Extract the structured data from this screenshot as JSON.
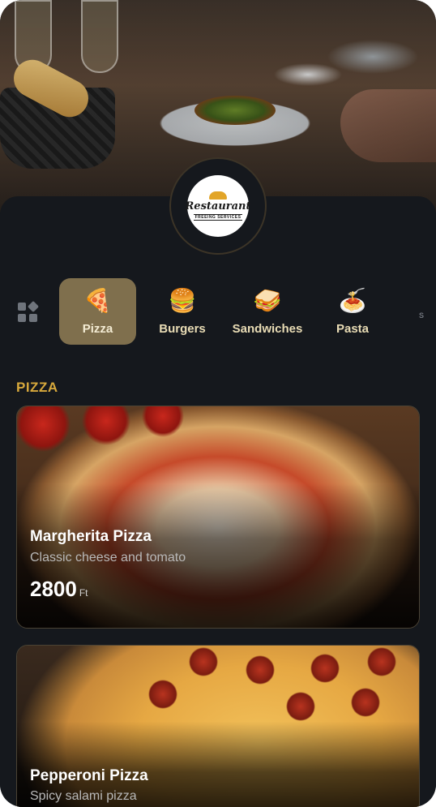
{
  "hero": {
    "logo_name": "Restaurant",
    "logo_sub": "FREEING SERVICES"
  },
  "categories": [
    {
      "label": "Pizza",
      "icon": "pizza-icon",
      "glyph": "🍕",
      "active": true
    },
    {
      "label": "Burgers",
      "icon": "burger-icon",
      "glyph": "🍔",
      "active": false
    },
    {
      "label": "Sandwiches",
      "icon": "sandwich-icon",
      "glyph": "🥪",
      "active": false
    },
    {
      "label": "Pasta",
      "icon": "pasta-icon",
      "glyph": "🍝",
      "active": false
    },
    {
      "label": "S",
      "icon": "more-icon",
      "glyph": "",
      "active": false
    }
  ],
  "section": {
    "title": "PIZZA"
  },
  "items": [
    {
      "name": "Margherita Pizza",
      "description": "Classic cheese and tomato",
      "price": "2800",
      "currency": "Ft"
    },
    {
      "name": "Pepperoni Pizza",
      "description": "Spicy salami pizza"
    }
  ],
  "colors": {
    "background": "#15181d",
    "accent": "#d8a93c",
    "active_category": "#7f6f4d"
  }
}
